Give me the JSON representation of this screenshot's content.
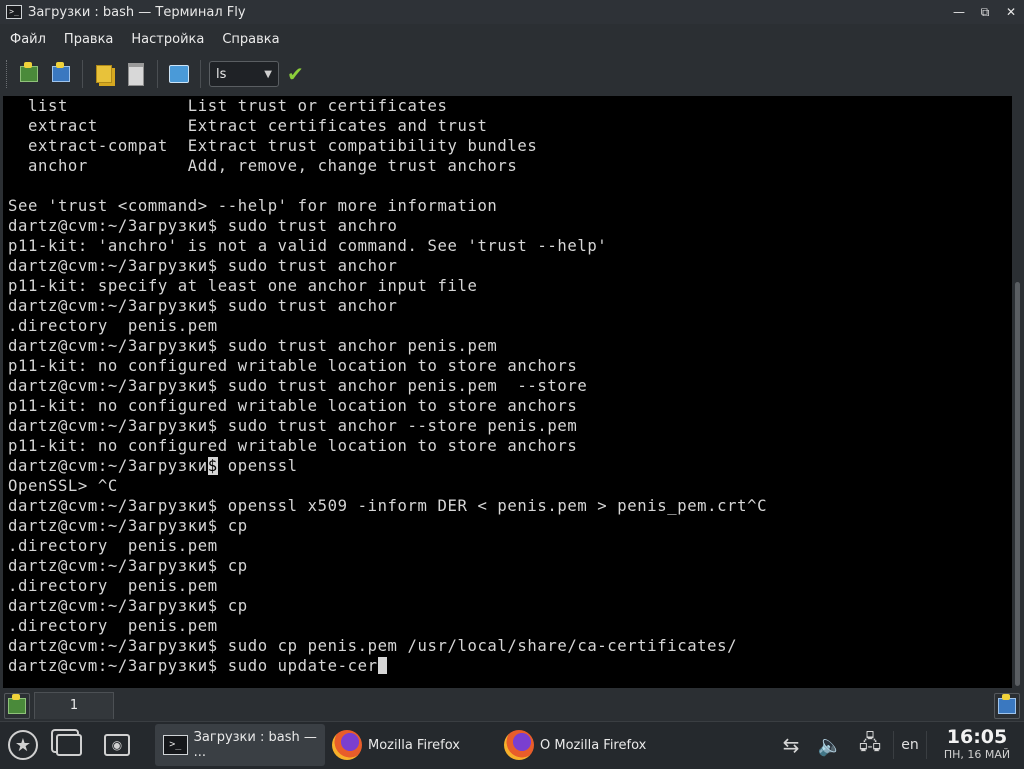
{
  "window": {
    "title": "Загрузки : bash — Терминал Fly",
    "controls": [
      "minimize",
      "maximize",
      "close"
    ]
  },
  "menu": [
    "Файл",
    "Правка",
    "Настройка",
    "Справка"
  ],
  "toolbar": {
    "command_value": "ls",
    "icons": [
      "new-session-icon",
      "close-session-icon",
      "copy-icon",
      "paste-icon",
      "bookmarks-icon",
      "execute-check-icon"
    ]
  },
  "terminal": {
    "lines": [
      "  list            List trust or certificates",
      "  extract         Extract certificates and trust",
      "  extract-compat  Extract trust compatibility bundles",
      "  anchor          Add, remove, change trust anchors",
      "",
      "See 'trust <command> --help' for more information",
      "dartz@cvm:~/Загрузки$ sudo trust anchro",
      "p11-kit: 'anchro' is not a valid command. See 'trust --help'",
      "dartz@cvm:~/Загрузки$ sudo trust anchor",
      "p11-kit: specify at least one anchor input file",
      "dartz@cvm:~/Загрузки$ sudo trust anchor",
      ".directory  penis.pem",
      "dartz@cvm:~/Загрузки$ sudo trust anchor penis.pem",
      "p11-kit: no configured writable location to store anchors",
      "dartz@cvm:~/Загрузки$ sudo trust anchor penis.pem  --store",
      "p11-kit: no configured writable location to store anchors",
      "dartz@cvm:~/Загрузки$ sudo trust anchor --store penis.pem",
      "p11-kit: no configured writable location to store anchors",
      "dartz@cvm:~/Загрузки",
      "OpenSSL> ^C",
      "dartz@cvm:~/Загрузки$ openssl x509 -inform DER < penis.pem > penis_pem.crt^C",
      "dartz@cvm:~/Загрузки$ cp",
      ".directory  penis.pem",
      "dartz@cvm:~/Загрузки$ cp",
      ".directory  penis.pem",
      "dartz@cvm:~/Загрузки$ cp",
      ".directory  penis.pem",
      "dartz@cvm:~/Загрузки$ sudo cp penis.pem /usr/local/share/ca-certificates/",
      "dartz@cvm:~/Загрузки$ sudo update-cer"
    ],
    "highlight_char": "$",
    "highlight_rest": " openssl"
  },
  "session_tabs": [
    "1"
  ],
  "taskbar": {
    "tasks": [
      {
        "label": "Загрузки : bash — ...",
        "active": true
      },
      {
        "label": "Mozilla Firefox",
        "active": false
      },
      {
        "label": "О Mozilla Firefox",
        "active": false
      }
    ],
    "language": "en",
    "time": "16:05",
    "date": "ПН, 16 МАЙ"
  }
}
